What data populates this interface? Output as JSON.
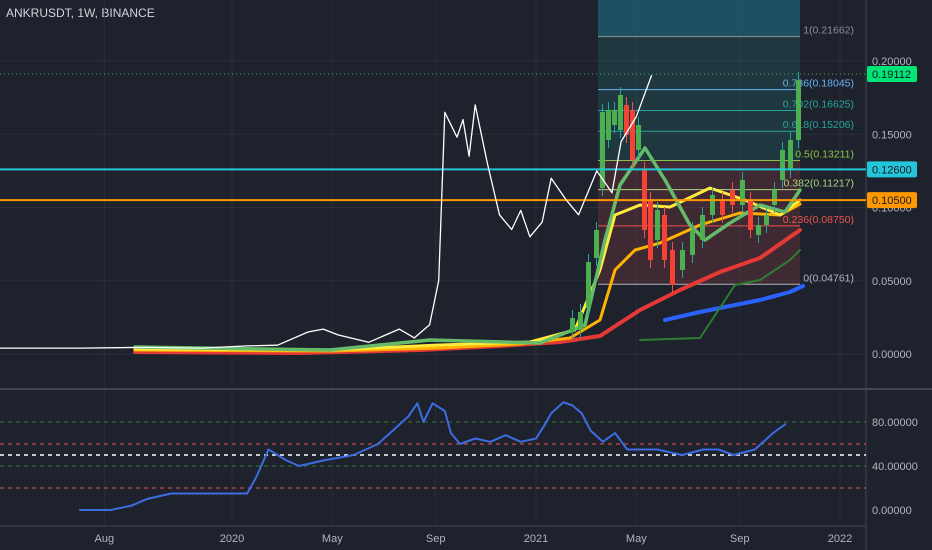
{
  "title": "ANKRUSDT, 1W, BINANCE",
  "colors": {
    "background": "#1e222d",
    "grid": "#2a2e39",
    "price_line": "#ffffff",
    "cyan_level": "#26c6da",
    "orange_level": "#ff9800",
    "rsi_line": "#3d6be0",
    "rsi_upper": "#2e7d32",
    "rsi_lower": "#ef5350",
    "blue_trend": "#2962ff"
  },
  "time_axis": [
    "Aug",
    "2020",
    "May",
    "Sep",
    "2021",
    "May",
    "Sep",
    "2022"
  ],
  "price_axis": [
    "0.20000",
    "0.15000",
    "0.10000",
    "0.05000",
    "0.00000"
  ],
  "rsi_axis": [
    "80.00000",
    "40.00000",
    "0.00000"
  ],
  "price_tags": [
    {
      "label": "0.19112",
      "value": 0.19112,
      "color": "#00e676"
    },
    {
      "label": "0.12600",
      "value": 0.126,
      "color": "#26c6da"
    },
    {
      "label": "0.10500",
      "value": 0.105,
      "color": "#ff9800"
    }
  ],
  "fib_levels": [
    {
      "label": "1(0.21662)",
      "value": 0.21662,
      "color": "#8a8f99"
    },
    {
      "label": "0.786(0.18045)",
      "value": 0.18045,
      "color": "#64b5f6"
    },
    {
      "label": "0.702(0.16625)",
      "value": 0.16625,
      "color": "#26a69a"
    },
    {
      "label": "0.618(0.15206)",
      "value": 0.15206,
      "color": "#26a69a"
    },
    {
      "label": "0.5(0.13211)",
      "value": 0.13211,
      "color": "#8bc34a"
    },
    {
      "label": "0.382(0.11217)",
      "value": 0.11217,
      "color": "#aed581"
    },
    {
      "label": "0.236(0.08750)",
      "value": 0.0875,
      "color": "#ef5350"
    },
    {
      "label": "0(0.04761)",
      "value": 0.04761,
      "color": "#b2b5be"
    }
  ],
  "chart_data": [
    {
      "type": "line",
      "title": "ANKRUSDT, 1W, BINANCE",
      "x_ticks": [
        "Aug",
        "2020",
        "May",
        "Sep",
        "2021",
        "May",
        "Sep",
        "2022"
      ],
      "ylim": [
        -0.012,
        0.235
      ],
      "y_ticks": [
        0.0,
        0.05,
        0.1,
        0.15,
        0.2
      ],
      "horizontal_levels": [
        0.126,
        0.105
      ],
      "last_price": 0.19112,
      "series": [
        {
          "points": [
            [
              2019.5,
              0.004
            ],
            [
              2019.7,
              0.0045
            ],
            [
              2019.9,
              0.004
            ],
            [
              2020.05,
              0.0055
            ],
            [
              2020.15,
              0.006
            ],
            [
              2020.25,
              0.015
            ],
            [
              2020.3,
              0.017
            ],
            [
              2020.35,
              0.013
            ],
            [
              2020.45,
              0.008
            ],
            [
              2020.55,
              0.017
            ],
            [
              2020.6,
              0.011
            ],
            [
              2020.65,
              0.02
            ],
            [
              2020.68,
              0.05
            ],
            [
              2020.7,
              0.165
            ],
            [
              2020.74,
              0.148
            ],
            [
              2020.76,
              0.16
            ],
            [
              2020.78,
              0.135
            ],
            [
              2020.8,
              0.17
            ],
            [
              2020.84,
              0.13
            ],
            [
              2020.88,
              0.095
            ],
            [
              2020.92,
              0.085
            ],
            [
              2020.95,
              0.098
            ],
            [
              2020.98,
              0.08
            ],
            [
              2021.02,
              0.09
            ],
            [
              2021.05,
              0.12
            ],
            [
              2021.1,
              0.105
            ],
            [
              2021.14,
              0.095
            ],
            [
              2021.2,
              0.125
            ],
            [
              2021.25,
              0.11
            ],
            [
              2021.28,
              0.145
            ],
            [
              2021.33,
              0.162
            ],
            [
              2021.38,
              0.19
            ]
          ]
        }
      ]
    },
    {
      "type": "line",
      "title": "",
      "x_ticks": [
        "Aug",
        "2020",
        "May",
        "Sep",
        "2021",
        "May",
        "Sep",
        "2022"
      ],
      "ylim": [
        -2,
        102
      ],
      "y_ticks": [
        0,
        40,
        80
      ],
      "reference_levels": [
        80,
        60,
        50,
        40,
        20
      ],
      "series": [
        {
          "points": [
            [
              2019.5,
              0
            ],
            [
              2019.6,
              0
            ],
            [
              2019.67,
              4
            ],
            [
              2019.72,
              10
            ],
            [
              2019.8,
              15
            ],
            [
              2019.9,
              15
            ],
            [
              2020.0,
              15
            ],
            [
              2020.05,
              15
            ],
            [
              2020.08,
              30
            ],
            [
              2020.12,
              55
            ],
            [
              2020.18,
              45
            ],
            [
              2020.22,
              40
            ],
            [
              2020.3,
              45
            ],
            [
              2020.4,
              50
            ],
            [
              2020.48,
              60
            ],
            [
              2020.52,
              70
            ],
            [
              2020.58,
              85
            ],
            [
              2020.61,
              97
            ],
            [
              2020.63,
              80
            ],
            [
              2020.66,
              97
            ],
            [
              2020.7,
              90
            ],
            [
              2020.72,
              70
            ],
            [
              2020.75,
              60
            ],
            [
              2020.8,
              65
            ],
            [
              2020.85,
              62
            ],
            [
              2020.9,
              68
            ],
            [
              2020.95,
              62
            ],
            [
              2021.0,
              65
            ],
            [
              2021.03,
              78
            ],
            [
              2021.05,
              88
            ],
            [
              2021.09,
              98
            ],
            [
              2021.12,
              95
            ],
            [
              2021.15,
              88
            ],
            [
              2021.18,
              72
            ],
            [
              2021.22,
              62
            ],
            [
              2021.26,
              70
            ],
            [
              2021.3,
              55
            ],
            [
              2021.4,
              55
            ],
            [
              2021.48,
              50
            ],
            [
              2021.55,
              55
            ],
            [
              2021.6,
              55
            ],
            [
              2021.65,
              50
            ],
            [
              2021.72,
              55
            ],
            [
              2021.78,
              70
            ],
            [
              2021.82,
              78
            ]
          ]
        }
      ]
    }
  ]
}
